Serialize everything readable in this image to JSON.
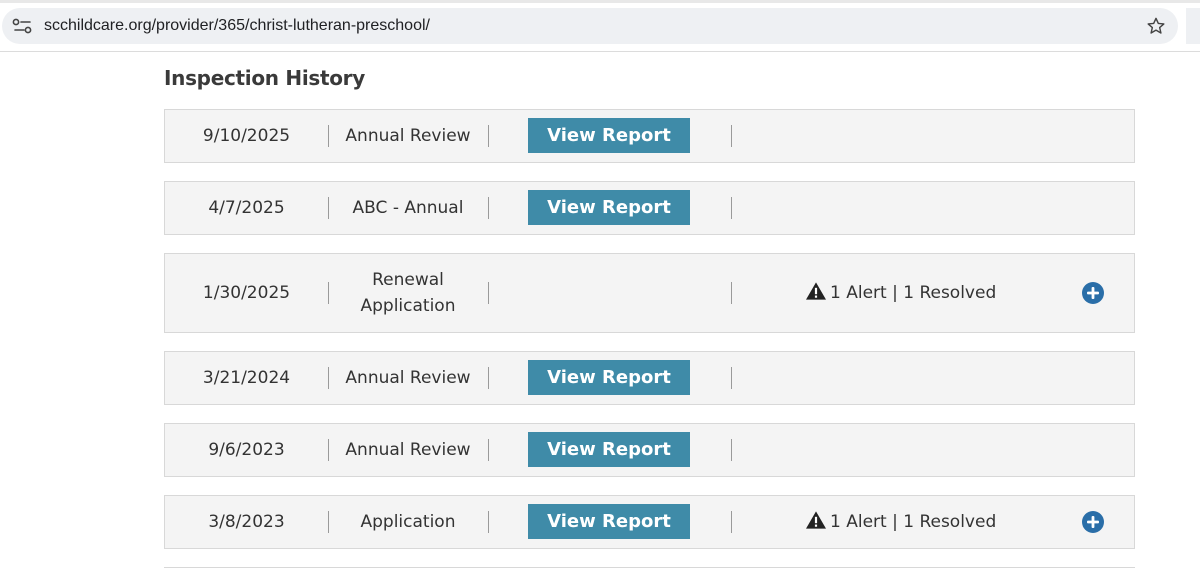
{
  "browser": {
    "url": "scchildcare.org/provider/365/christ-lutheran-preschool/",
    "site_icon": "tune-icon",
    "bookmark_icon": "star-icon"
  },
  "page": {
    "heading": "Inspection History",
    "accent_color": "#3f8ba8",
    "inspections": [
      {
        "date": "9/10/2025",
        "type": "Annual Review",
        "report_label": "View Report",
        "alert_text": ""
      },
      {
        "date": "4/7/2025",
        "type": "ABC - Annual",
        "report_label": "View Report",
        "alert_text": ""
      },
      {
        "date": "1/30/2025",
        "type": "Renewal Application",
        "report_label": "",
        "alert_text": "1 Alert | 1 Resolved"
      },
      {
        "date": "3/21/2024",
        "type": "Annual Review",
        "report_label": "View Report",
        "alert_text": ""
      },
      {
        "date": "9/6/2023",
        "type": "Annual Review",
        "report_label": "View Report",
        "alert_text": ""
      },
      {
        "date": "3/8/2023",
        "type": "Application",
        "report_label": "View Report",
        "alert_text": "1 Alert | 1 Resolved"
      }
    ]
  }
}
